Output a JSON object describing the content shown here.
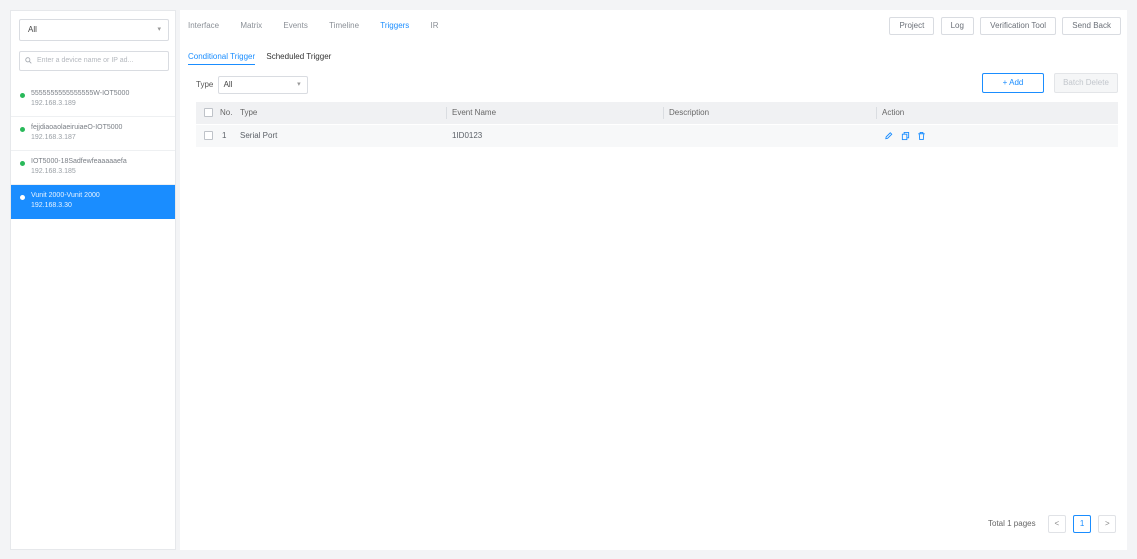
{
  "sidebar": {
    "scope_value": "All",
    "search_placeholder": "Enter a device name or IP ad...",
    "devices": [
      {
        "name": "5555555555555555W-IOT5000",
        "ip": "192.168.3.189",
        "status": "online",
        "selected": false
      },
      {
        "name": "fejjdiaoaolaeiruiaeO-IOT5000",
        "ip": "192.168.3.187",
        "status": "online",
        "selected": false
      },
      {
        "name": "IOT5000-18Sadfewfeaaaaaefa",
        "ip": "192.168.3.185",
        "status": "online",
        "selected": false
      },
      {
        "name": "Vunit 2000-Vunit 2000",
        "ip": "192.168.3.30",
        "status": "online",
        "selected": true
      }
    ]
  },
  "header": {
    "tabs": [
      "Interface",
      "Matrix",
      "Events",
      "Timeline",
      "Triggers",
      "IR"
    ],
    "active_tab": "Triggers",
    "actions": {
      "project": "Project",
      "log": "Log",
      "verification_tool": "Verification Tool",
      "send_back": "Send Back"
    }
  },
  "sub_tabs": {
    "conditional": "Conditional Trigger",
    "scheduled": "Scheduled Trigger",
    "active": "Conditional Trigger"
  },
  "filter": {
    "label": "Type",
    "value": "All"
  },
  "buttons": {
    "add": "+ Add",
    "batch_delete": "Batch Delete"
  },
  "table": {
    "headers": {
      "no": "No.",
      "type": "Type",
      "event_name": "Event Name",
      "description": "Description",
      "action": "Action"
    },
    "rows": [
      {
        "no": "1",
        "type": "Serial Port",
        "event_name": "1ID0123",
        "description": ""
      }
    ]
  },
  "pagination": {
    "total": "Total 1 pages",
    "prev": "<",
    "current": "1",
    "next": ">"
  },
  "colors": {
    "accent": "#1a8dff",
    "online": "#29b95a",
    "selected_bg": "#1a8dff"
  }
}
